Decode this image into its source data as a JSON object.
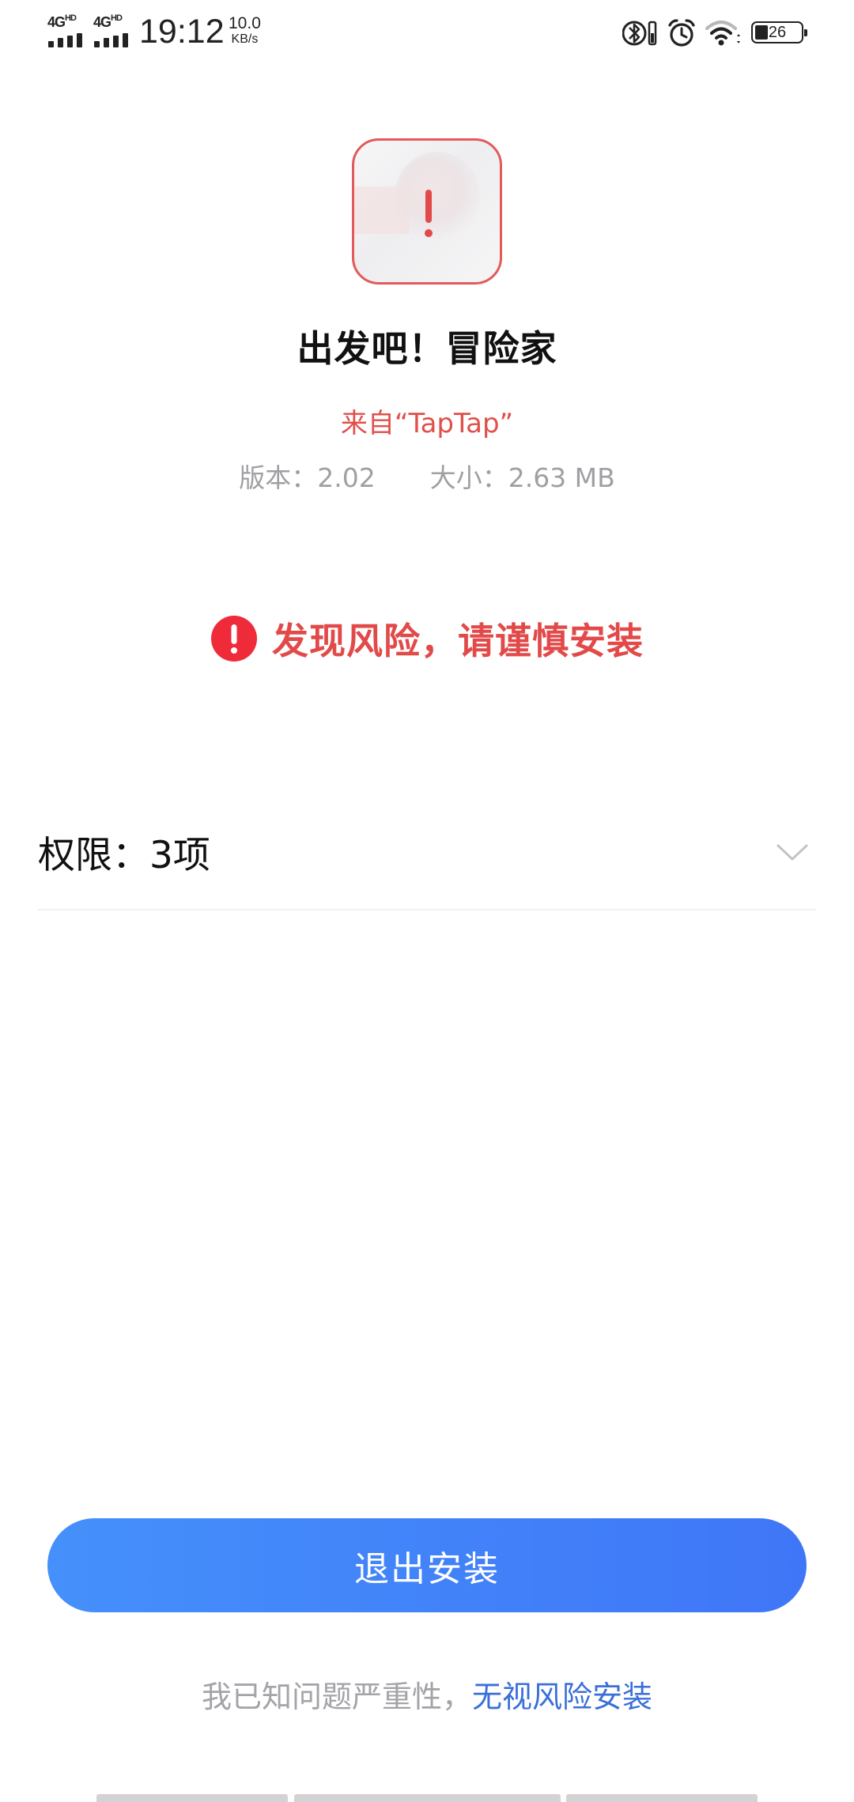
{
  "status_bar": {
    "sim1": {
      "net": "4G",
      "sup": "HD"
    },
    "sim2": {
      "net": "4G",
      "sup": "HD"
    },
    "time": "19:12",
    "speed_value": "10.0",
    "speed_unit": "KB/s",
    "icons": [
      "bluetooth-icon",
      "alarm-icon",
      "wifi-icon"
    ],
    "battery_level": "26"
  },
  "app": {
    "name": "出发吧！冒险家",
    "source": "来自“TapTap”",
    "version_label": "版本：",
    "version": "2.02",
    "size_label": "大小：",
    "size": "2.63 MB",
    "icon_border_color": "#e25a5a"
  },
  "warning": {
    "text": "发现风险，请谨慎安装",
    "color": "#e24a4a"
  },
  "permissions": {
    "label": "权限：",
    "count": "3项"
  },
  "actions": {
    "exit_label": "退出安装",
    "ignore_prefix": "我已知问题严重性，",
    "ignore_link": "无视风险安装",
    "accent": "#3f7af7"
  }
}
